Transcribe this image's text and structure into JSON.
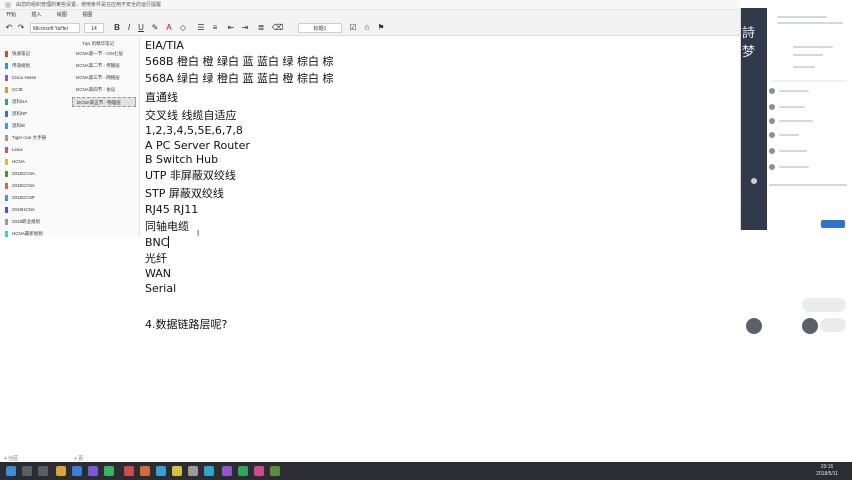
{
  "notice": {
    "text": "由您的组织管理的某些设置。使用条件是在应用不安全的运行提醒"
  },
  "ribbon": {
    "tabs": [
      "开始",
      "插入",
      "绘图",
      "视图"
    ]
  },
  "toolbar": {
    "font": "Microsoft YaHei",
    "size": "14",
    "style": "标题1"
  },
  "sidebar": {
    "header": "Tips 的精华笔记",
    "sections": [
      {
        "label": "快速笔记",
        "color": "#d64a3a"
      },
      {
        "label": "传递规划",
        "color": "#3a8fd6"
      },
      {
        "label": "Cisco Notes",
        "color": "#8e59c7"
      },
      {
        "label": "CCIE",
        "color": "#d69a3a"
      },
      {
        "label": "思科NA",
        "color": "#3aa25f"
      },
      {
        "label": "思科NP",
        "color": "#3a6cd6"
      },
      {
        "label": "思科IE",
        "color": "#2ba8c9"
      },
      {
        "label": "Tiger ccie 大手册",
        "color": "#9c9c9c"
      },
      {
        "label": "Linux",
        "color": "#c94d8e"
      },
      {
        "label": "HCNA",
        "color": "#d6c23a"
      },
      {
        "label": "2018CCNA",
        "color": "#5d8d3a"
      },
      {
        "label": "2018CCNA",
        "color": "#d66a3a"
      },
      {
        "label": "2018CCNP",
        "color": "#3a9fd6"
      },
      {
        "label": "2018HCNA",
        "color": "#7a3ad6"
      },
      {
        "label": "2018职业规划",
        "color": "#9a9a9a"
      },
      {
        "label": "HCNA最新视频",
        "color": "#3ad6b3"
      }
    ],
    "pages": [
      "DCNA第一节 - OSI七层",
      "DCNA第二节 - 传输层",
      "DCNA第三节 - 网络层",
      "DCNA第四节 - 协议",
      "DCNA第五节 - 物理层"
    ],
    "add_section": "+ 分区",
    "add_page": "+ 页"
  },
  "note": {
    "lines": [
      "EIA/TIA",
      "568B  橙白 橙 绿白 蓝 蓝白 绿 棕白 棕",
      "568A  绿白 绿 橙白 蓝 蓝白 橙 棕白 棕",
      "直通线",
      "交叉线   线缆自适应",
      "1,2,3,4,5,5E,6,7,8",
      "A PC Server Router",
      "B Switch Hub",
      "UTP  非屏蔽双绞线",
      "STP  屏蔽双绞线",
      "RJ45    RJ11",
      "同轴电缆",
      "BNC",
      "光纤",
      "WAN",
      "Serial",
      "4.数据链路层呢?"
    ]
  },
  "rightapp": {
    "big_text": "詩梦"
  },
  "taskbar": {
    "time": "20:16",
    "date": "2018/5/11"
  }
}
